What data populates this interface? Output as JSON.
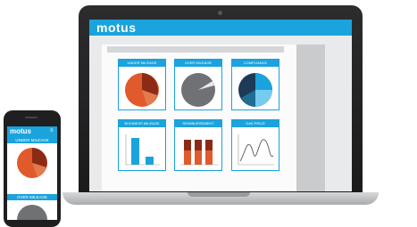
{
  "app": {
    "logo": "motus"
  },
  "laptop": {
    "cards": [
      {
        "title": "UNDER MILEAGE",
        "icon": "pie-chart-icon",
        "colors": [
          "#e15a2b",
          "#8b2b16",
          "#e37a4f"
        ]
      },
      {
        "title": "OVER MILEAGE",
        "icon": "pie-chart-icon",
        "colors": [
          "#6f7174",
          "#e7e7e7"
        ]
      },
      {
        "title": "COMPLIANCE",
        "icon": "pie-chart-icon",
        "colors": [
          "#1f6e93",
          "#1aa3dc",
          "#1d3b57",
          "#76ccef"
        ]
      },
      {
        "title": "BUSINESS MILEAGE",
        "icon": "bar-chart-icon",
        "colors": [
          "#1aa3dc"
        ]
      },
      {
        "title": "REIMBURSEMENT",
        "icon": "stacked-bar-chart-icon",
        "colors": [
          "#8b2b16",
          "#e15a2b"
        ]
      },
      {
        "title": "GAS PRICE",
        "icon": "line-chart-icon",
        "colors": [
          "#555555"
        ]
      }
    ]
  },
  "phone": {
    "logo": "motus",
    "menu_icon": "menu-icon",
    "sections": [
      {
        "label": "UNDER MILEAGE"
      },
      {
        "label": "OVER MILEAGE"
      }
    ]
  }
}
